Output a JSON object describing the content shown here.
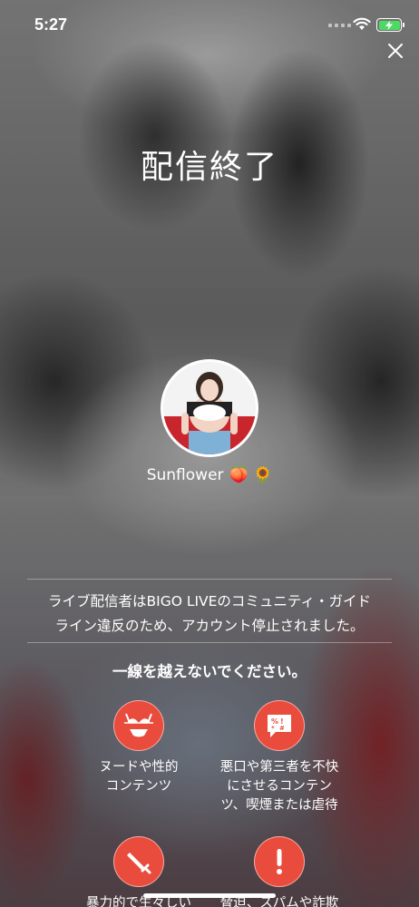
{
  "status_bar": {
    "time": "5:27"
  },
  "header": {
    "title": "配信終了"
  },
  "streamer": {
    "name": "Sunflower",
    "emojis": "🍑 🌻"
  },
  "notice": {
    "line1": "ライブ配信者はBIGO LIVEのコミュニティ・ガイド",
    "line2": "ライン違反のため、アカウント停止されました。"
  },
  "warning": "一線を越えないでください。",
  "rules": [
    {
      "icon": "bikini-icon",
      "line1": "ヌードや性的",
      "line2": "コンテンツ",
      "line3": ""
    },
    {
      "icon": "profanity-icon",
      "line1": "悪口や第三者を不快",
      "line2": "にさせるコンテン",
      "line3": "ツ、喫煙または虐待"
    },
    {
      "icon": "weapon-icon",
      "line1": "暴力的で生々しい",
      "line2": "",
      "line3": ""
    },
    {
      "icon": "exclamation-icon",
      "line1": "脅迫、スパムや詐欺",
      "line2": "",
      "line3": ""
    }
  ],
  "colors": {
    "accent": "#e94b3c",
    "battery": "#4cd964"
  }
}
